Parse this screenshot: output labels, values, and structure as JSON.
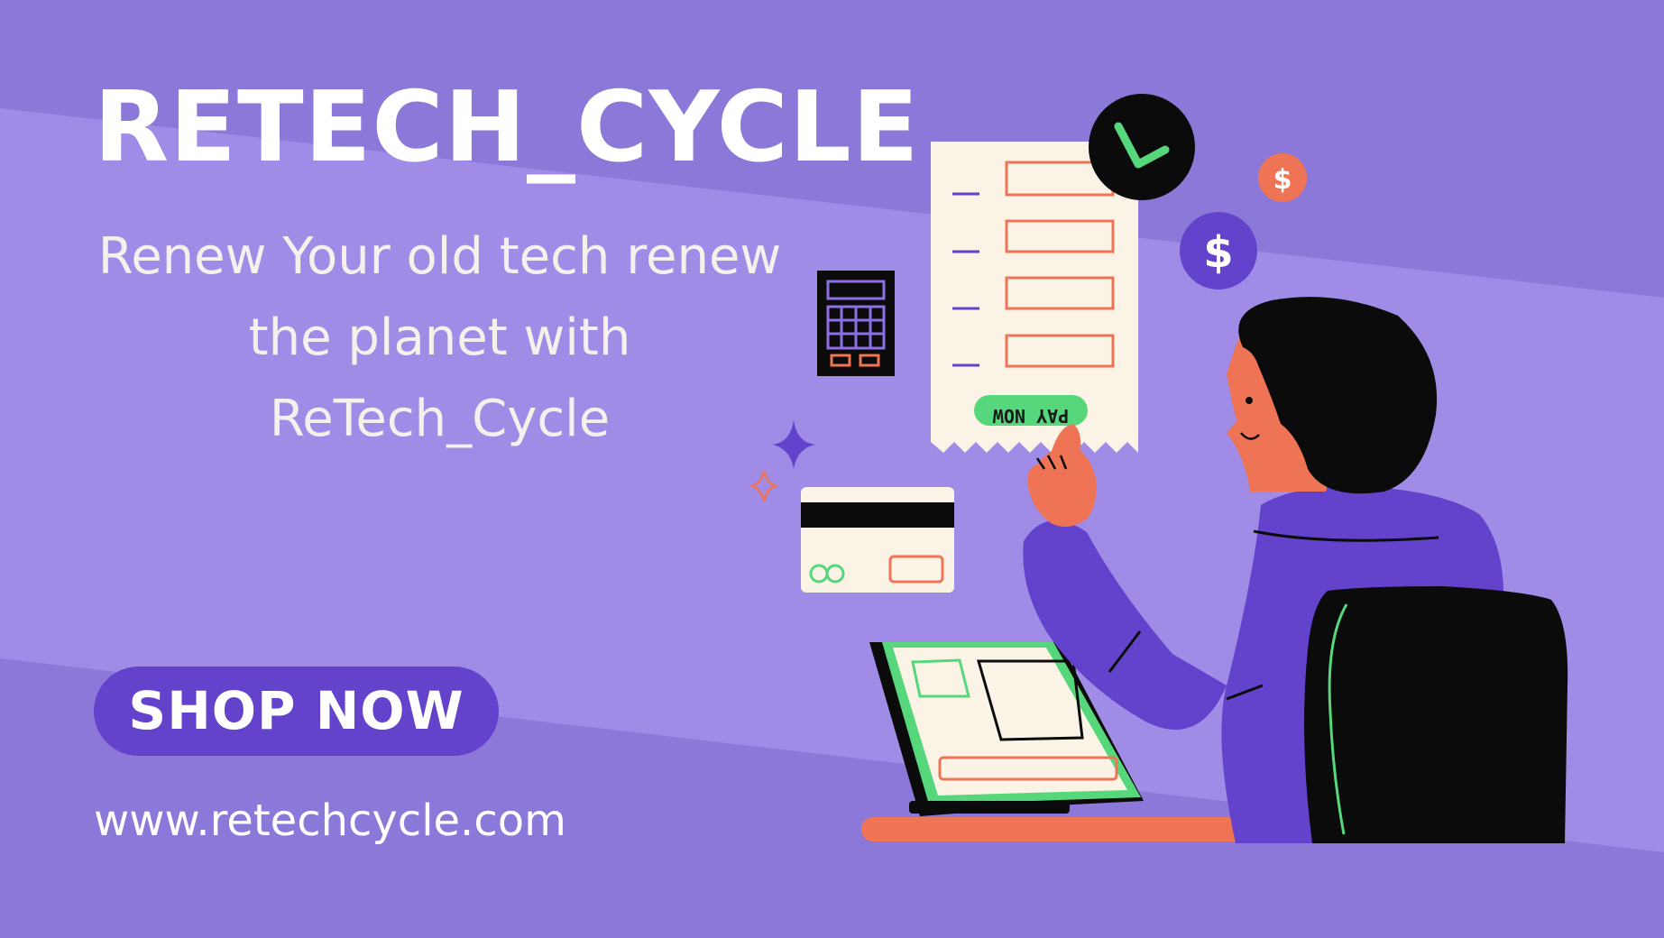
{
  "banner": {
    "title": "RETECH_CYCLE",
    "tagline_lines": [
      "Renew Your old tech renew",
      "the planet with",
      "ReTech_Cycle"
    ],
    "cta_label": "SHOP NOW",
    "website": "www.retechcycle.com"
  },
  "illustration": {
    "receipt_button_label": "PAY NOW",
    "icons": [
      "check-icon",
      "dollar-icon",
      "calculator-icon",
      "sparkle-icon",
      "credit-card-icon",
      "laptop-icon",
      "person-figure",
      "chair-icon"
    ]
  },
  "colors": {
    "background": "#8b78d8",
    "band": "#a08ce6",
    "button": "#6342cc",
    "accent_orange": "#ef7456",
    "accent_green": "#56d77c",
    "paper": "#fbf3e6"
  }
}
